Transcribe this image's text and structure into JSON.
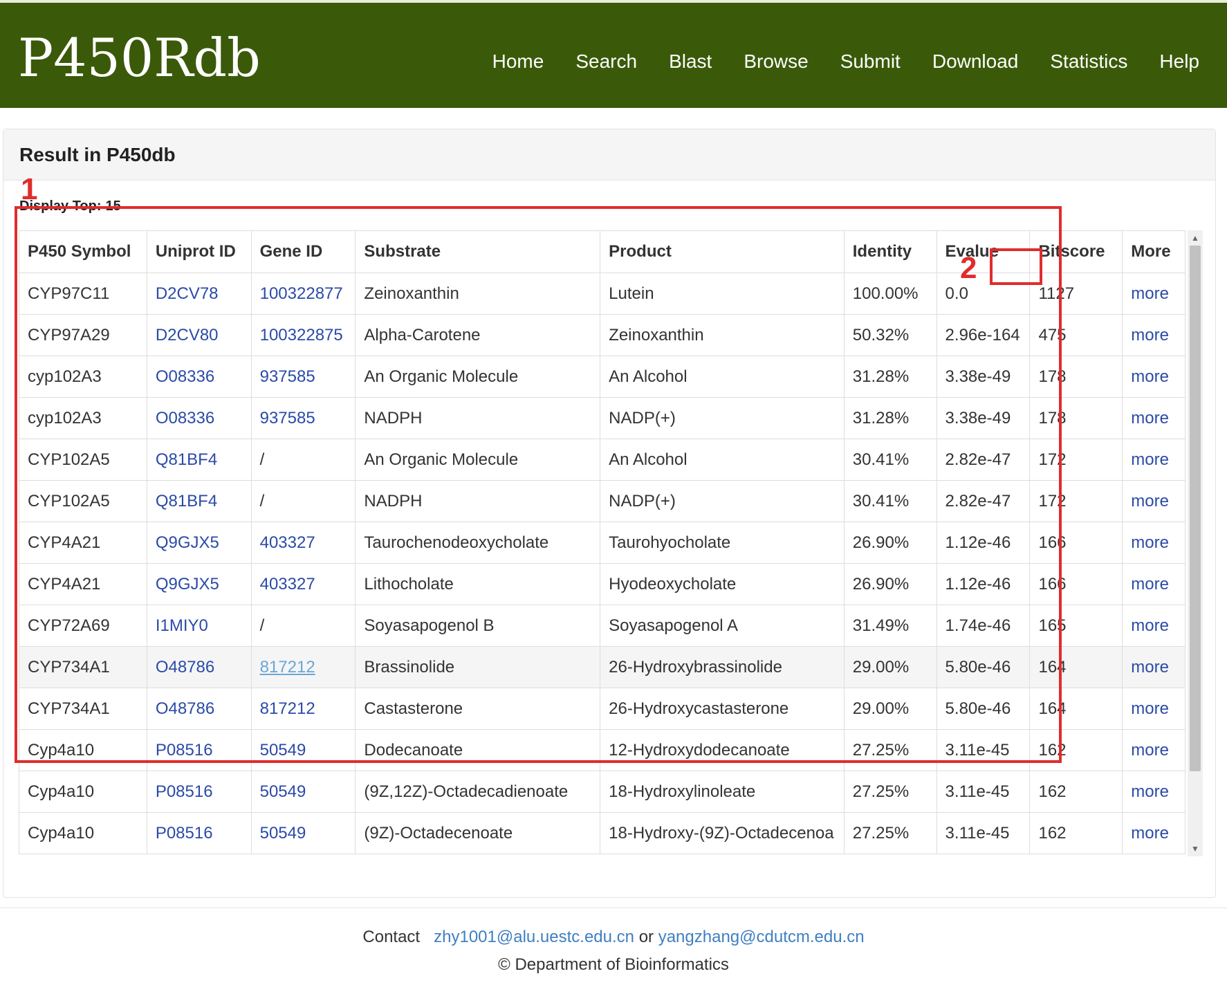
{
  "brand": "P450Rdb",
  "nav": [
    "Home",
    "Search",
    "Blast",
    "Browse",
    "Submit",
    "Download",
    "Statistics",
    "Help"
  ],
  "panel": {
    "title": "Result in P450db",
    "display_label": "Display Top:",
    "display_value": "15"
  },
  "table": {
    "headers": [
      "P450 Symbol",
      "Uniprot ID",
      "Gene ID",
      "Substrate",
      "Product",
      "Identity",
      "Evalue",
      "Bitscore",
      "More"
    ],
    "rows": [
      {
        "symbol": "CYP97C11",
        "uniprot": "D2CV78",
        "gene": "100322877",
        "substrate": "Zeinoxanthin",
        "product": "Lutein",
        "identity": "100.00%",
        "evalue": "0.0",
        "bitscore": "1127",
        "more": "more"
      },
      {
        "symbol": "CYP97A29",
        "uniprot": "D2CV80",
        "gene": "100322875",
        "substrate": "Alpha-Carotene",
        "product": "Zeinoxanthin",
        "identity": "50.32%",
        "evalue": "2.96e-164",
        "bitscore": "475",
        "more": "more"
      },
      {
        "symbol": "cyp102A3",
        "uniprot": "O08336",
        "gene": "937585",
        "substrate": "An Organic Molecule",
        "product": "An Alcohol",
        "identity": "31.28%",
        "evalue": "3.38e-49",
        "bitscore": "178",
        "more": "more"
      },
      {
        "symbol": "cyp102A3",
        "uniprot": "O08336",
        "gene": "937585",
        "substrate": "NADPH",
        "product": "NADP(+)",
        "identity": "31.28%",
        "evalue": "3.38e-49",
        "bitscore": "178",
        "more": "more"
      },
      {
        "symbol": "CYP102A5",
        "uniprot": "Q81BF4",
        "gene": "/",
        "substrate": "An Organic Molecule",
        "product": "An Alcohol",
        "identity": "30.41%",
        "evalue": "2.82e-47",
        "bitscore": "172",
        "more": "more"
      },
      {
        "symbol": "CYP102A5",
        "uniprot": "Q81BF4",
        "gene": "/",
        "substrate": "NADPH",
        "product": "NADP(+)",
        "identity": "30.41%",
        "evalue": "2.82e-47",
        "bitscore": "172",
        "more": "more"
      },
      {
        "symbol": "CYP4A21",
        "uniprot": "Q9GJX5",
        "gene": "403327",
        "substrate": "Taurochenodeoxycholate",
        "product": "Taurohyocholate",
        "identity": "26.90%",
        "evalue": "1.12e-46",
        "bitscore": "166",
        "more": "more"
      },
      {
        "symbol": "CYP4A21",
        "uniprot": "Q9GJX5",
        "gene": "403327",
        "substrate": "Lithocholate",
        "product": "Hyodeoxycholate",
        "identity": "26.90%",
        "evalue": "1.12e-46",
        "bitscore": "166",
        "more": "more"
      },
      {
        "symbol": "CYP72A69",
        "uniprot": "I1MIY0",
        "gene": "/",
        "substrate": "Soyasapogenol B",
        "product": "Soyasapogenol A",
        "identity": "31.49%",
        "evalue": "1.74e-46",
        "bitscore": "165",
        "more": "more"
      },
      {
        "symbol": "CYP734A1",
        "uniprot": "O48786",
        "gene": "817212",
        "substrate": "Brassinolide",
        "product": "26-Hydroxybrassinolide",
        "identity": "29.00%",
        "evalue": "5.80e-46",
        "bitscore": "164",
        "more": "more"
      },
      {
        "symbol": "CYP734A1",
        "uniprot": "O48786",
        "gene": "817212",
        "substrate": "Castasterone",
        "product": "26-Hydroxycastasterone",
        "identity": "29.00%",
        "evalue": "5.80e-46",
        "bitscore": "164",
        "more": "more"
      },
      {
        "symbol": "Cyp4a10",
        "uniprot": "P08516",
        "gene": "50549",
        "substrate": "Dodecanoate",
        "product": "12-Hydroxydodecanoate",
        "identity": "27.25%",
        "evalue": "3.11e-45",
        "bitscore": "162",
        "more": "more"
      },
      {
        "symbol": "Cyp4a10",
        "uniprot": "P08516",
        "gene": "50549",
        "substrate": "(9Z,12Z)-Octadecadienoate",
        "product": "18-Hydroxylinoleate",
        "identity": "27.25%",
        "evalue": "3.11e-45",
        "bitscore": "162",
        "more": "more"
      },
      {
        "symbol": "Cyp4a10",
        "uniprot": "P08516",
        "gene": "50549",
        "substrate": "(9Z)-Octadecenoate",
        "product": "18-Hydroxy-(9Z)-Octadecenoa",
        "identity": "27.25%",
        "evalue": "3.11e-45",
        "bitscore": "162",
        "more": "more"
      }
    ]
  },
  "annotations": {
    "label_1": "1",
    "label_2": "2"
  },
  "footer": {
    "contact_label": "Contact",
    "email1": "zhy1001@alu.uestc.edu.cn",
    "or": "or",
    "email2": "yangzhang@cdutcm.edu.cn",
    "copyright": "© Department of Bioinformatics"
  },
  "colors": {
    "navbar": "#3a5a09",
    "link": "#2b4aa8",
    "annotation": "#e02c2c"
  }
}
